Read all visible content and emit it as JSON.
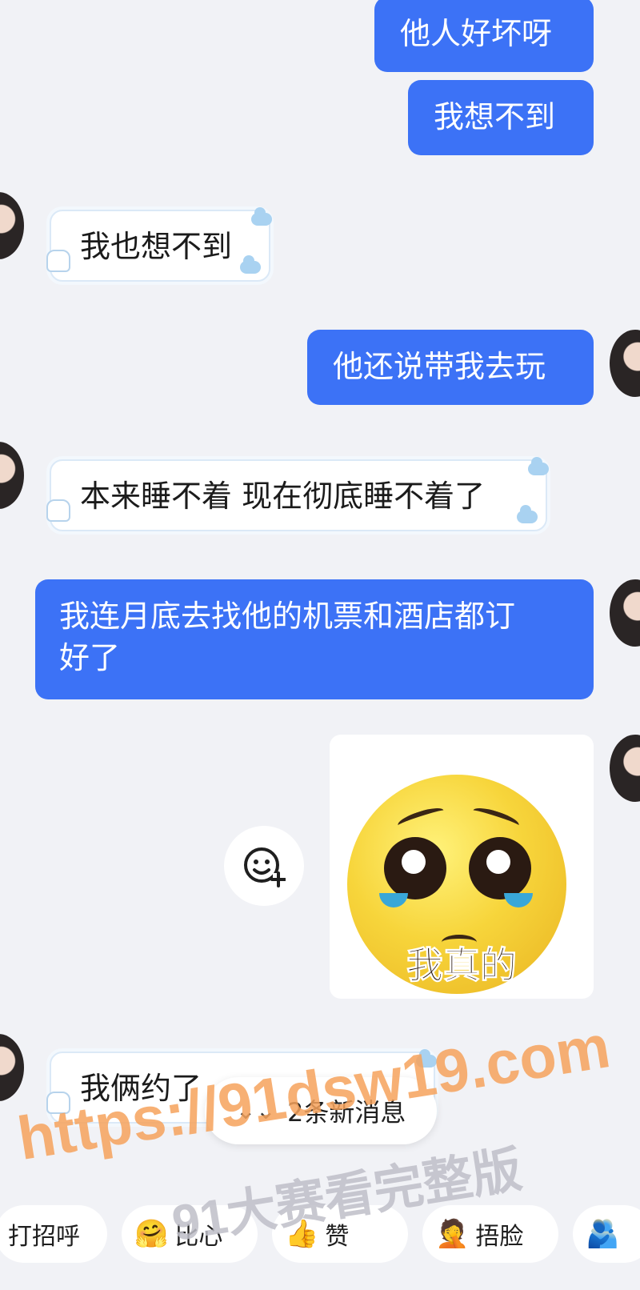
{
  "messages": [
    {
      "side": "out",
      "text": "他人好坏呀"
    },
    {
      "side": "out",
      "text": "我想不到"
    },
    {
      "side": "in",
      "text": "我也想不到"
    },
    {
      "side": "out",
      "text": "他还说带我去玩"
    },
    {
      "side": "in",
      "text": "本来睡不着 现在彻底睡不着了"
    },
    {
      "side": "out",
      "text": "我连月底去找他的机票和酒店都订好了",
      "text_line1": "我连月底去找他的机票和酒店都订",
      "text_line2": "好了"
    },
    {
      "side": "out",
      "type": "sticker",
      "caption": "我真的"
    },
    {
      "side": "in",
      "text": "我俩约了"
    }
  ],
  "new_messages_pill": {
    "label": "2条新消息",
    "icon": "double-chevron-down-icon"
  },
  "quick_replies": [
    {
      "label": "打招呼",
      "icon": ""
    },
    {
      "label": "比心",
      "icon": "heart-hands-emoji"
    },
    {
      "label": "赞",
      "icon": "thumbs-up-emoji"
    },
    {
      "label": "捂脸",
      "icon": "facepalm-emoji"
    },
    {
      "label": "",
      "icon": "hug-emoji"
    }
  ],
  "watermark": {
    "url": "https://91dsw19.com",
    "text": "91大赛看完整版"
  },
  "colors": {
    "outgoing_bubble": "#3c72f6",
    "incoming_bubble": "#ffffff",
    "background": "#f1f2f6"
  }
}
